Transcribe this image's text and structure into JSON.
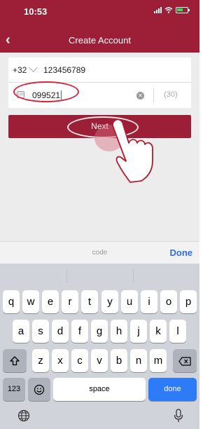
{
  "status_bar": {
    "time": "10:53"
  },
  "nav": {
    "back_icon": "chevron-left-icon",
    "title": "Create Account"
  },
  "form": {
    "country_code": "+32",
    "phone_number": "123456789",
    "verification_code": "099521",
    "countdown": "(30)"
  },
  "next_button": {
    "label": "Next"
  },
  "keyboard_accessory": {
    "label": "code",
    "done": "Done"
  },
  "keyboard": {
    "row1": [
      "q",
      "w",
      "e",
      "r",
      "t",
      "y",
      "u",
      "i",
      "o",
      "p"
    ],
    "row2": [
      "a",
      "s",
      "d",
      "f",
      "g",
      "h",
      "j",
      "k",
      "l"
    ],
    "row3": [
      "z",
      "x",
      "c",
      "v",
      "b",
      "n",
      "m"
    ],
    "numbers_key": "123",
    "space_key": "space",
    "return_key": "done"
  },
  "colors": {
    "brand": "#9c1f37",
    "accent": "#2d6cf0",
    "highlight_ring": "#d6263b"
  }
}
